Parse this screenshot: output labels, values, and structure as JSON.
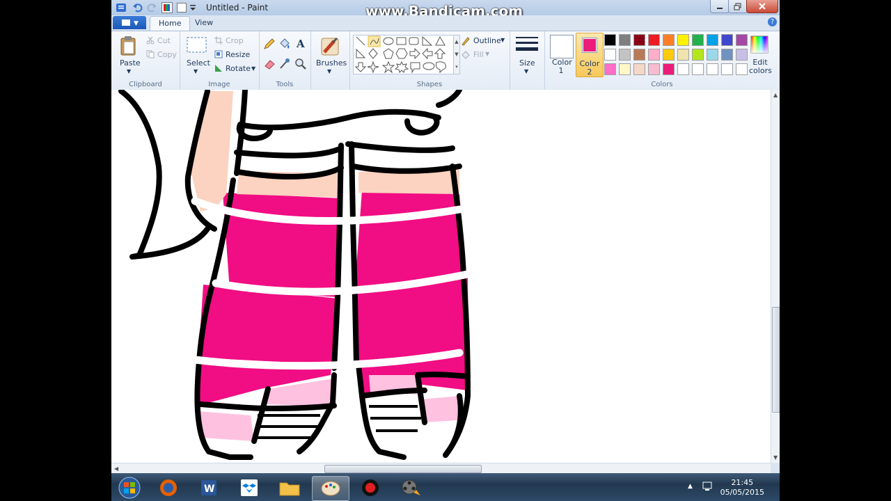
{
  "window": {
    "title": "Untitled - Paint"
  },
  "watermark": "www.Bandicam.com",
  "tabs": [
    {
      "label": "Home"
    },
    {
      "label": "View"
    }
  ],
  "help_glyph": "?",
  "clipboard": {
    "paste": "Paste",
    "cut": "Cut",
    "copy": "Copy",
    "group": "Clipboard"
  },
  "image": {
    "select": "Select",
    "crop": "Crop",
    "resize": "Resize",
    "rotate": "Rotate",
    "group": "Image"
  },
  "tools": {
    "group": "Tools",
    "icons": [
      "pencil-icon",
      "fill-icon",
      "text-icon",
      "eraser-icon",
      "color-picker-icon",
      "magnifier-icon"
    ]
  },
  "brushes": {
    "label": "Brushes"
  },
  "shapes": {
    "group": "Shapes",
    "outline": "Outline",
    "fill": "Fill"
  },
  "size": {
    "label": "Size"
  },
  "colors": {
    "color1_label": "Color 1",
    "color2_label": "Color 2",
    "group": "Colors",
    "edit": "Edit colors",
    "color1": "#ffffff",
    "color2": "#ec1c7a",
    "row1": [
      "#000000",
      "#7f7f7f",
      "#880015",
      "#ed1c24",
      "#ff7f27",
      "#fff200",
      "#22b14c",
      "#00a2e8",
      "#3f48cc",
      "#a349a4"
    ],
    "row2": [
      "#ffffff",
      "#c3c3c3",
      "#b97a57",
      "#ffaec9",
      "#ffc90e",
      "#efe4b0",
      "#b5e61d",
      "#99d9ea",
      "#7092be",
      "#c8bfe7"
    ],
    "row3": [
      "#ff6ec7",
      "#fff8c6",
      "#f5d7c8",
      "#f7bccf",
      "#ec1c7a",
      "#ffffff",
      "#ffffff",
      "#ffffff",
      "#ffffff",
      "#ffffff"
    ]
  },
  "drawing": {
    "pink": "#f10d83",
    "skin": "#fbd3c0",
    "light_pink": "#ffc1e0",
    "outline": "#000000"
  },
  "taskbar": {
    "time": "21:45",
    "date": "05/05/2015"
  }
}
